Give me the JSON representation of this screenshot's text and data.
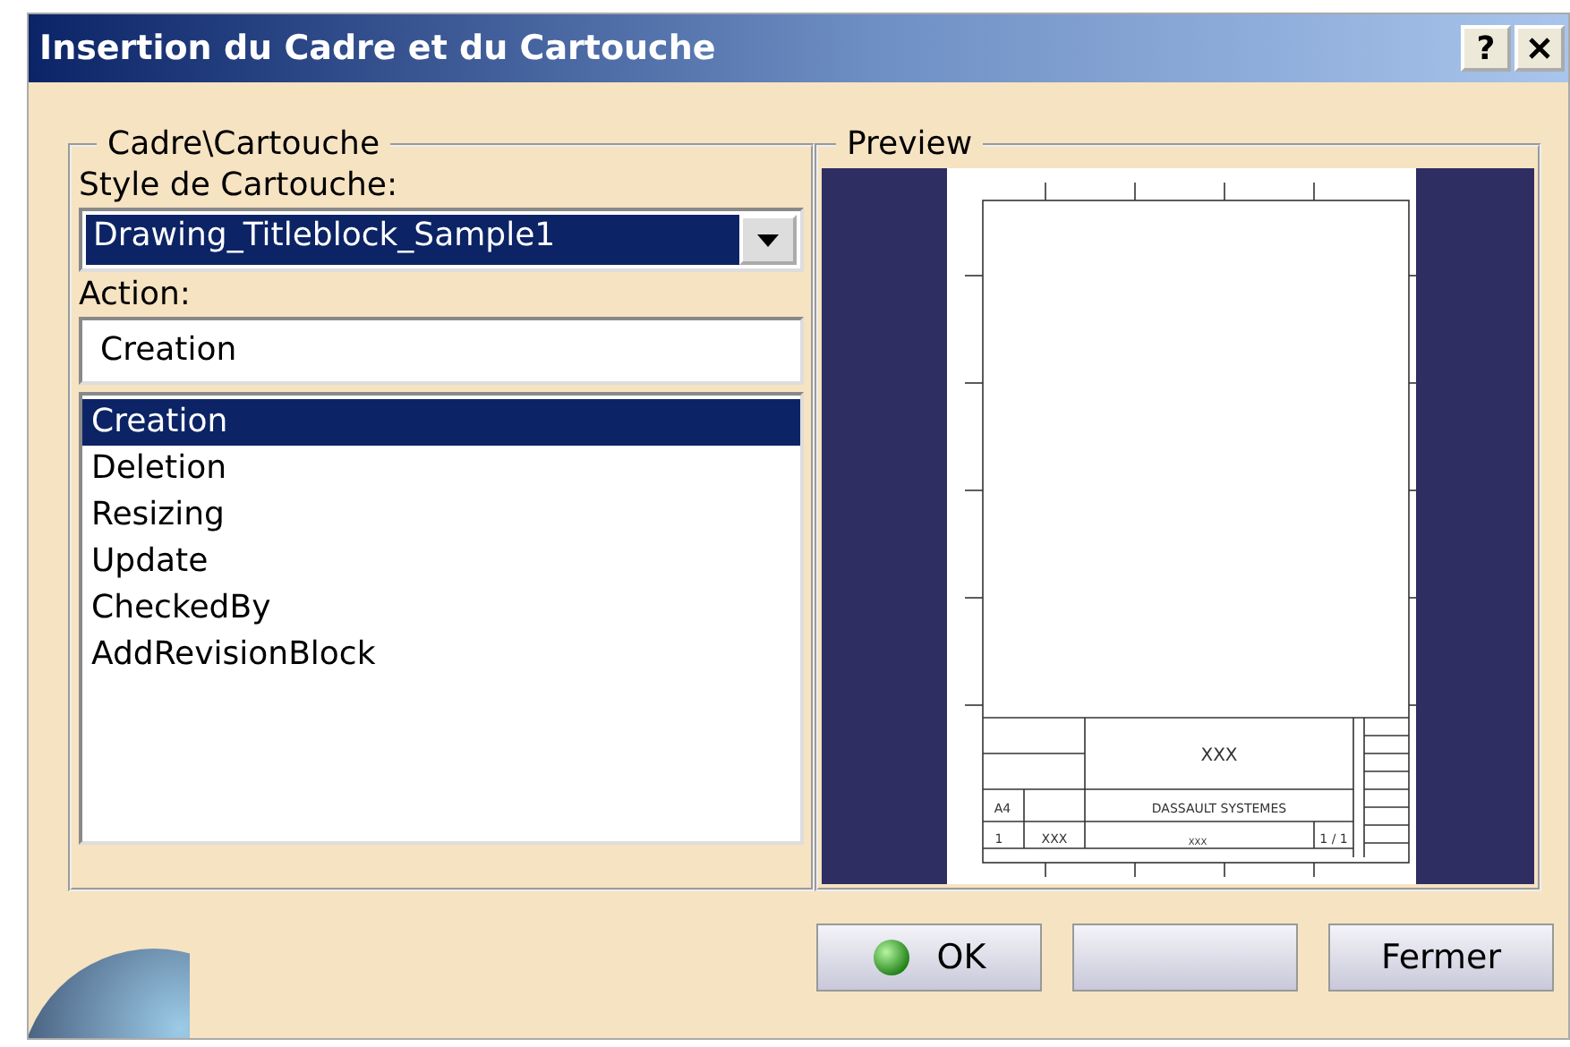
{
  "window": {
    "title": "Insertion du Cadre et du Cartouche",
    "help_label": "?"
  },
  "frame_group": {
    "legend": "Cadre\\Cartouche",
    "style_label": "Style de Cartouche:",
    "style_value": "Drawing_Titleblock_Sample1",
    "action_label": "Action:",
    "action_value": "Creation",
    "actions": [
      {
        "label": "Creation",
        "selected": true
      },
      {
        "label": "Deletion",
        "selected": false
      },
      {
        "label": "Resizing",
        "selected": false
      },
      {
        "label": "Update",
        "selected": false
      },
      {
        "label": "CheckedBy",
        "selected": false
      },
      {
        "label": "AddRevisionBlock",
        "selected": false
      }
    ]
  },
  "preview": {
    "legend": "Preview",
    "titleblock": {
      "title": "XXX",
      "company": "DASSAULT SYSTEMES",
      "format": "A4",
      "scale": "1",
      "number": "XXX",
      "sheet": "1 / 1",
      "name": "XXX"
    }
  },
  "buttons": [
    {
      "kind": "ok",
      "label": "OK"
    },
    {
      "kind": "blank"
    },
    {
      "kind": "plain",
      "label": "Fermer"
    }
  ]
}
